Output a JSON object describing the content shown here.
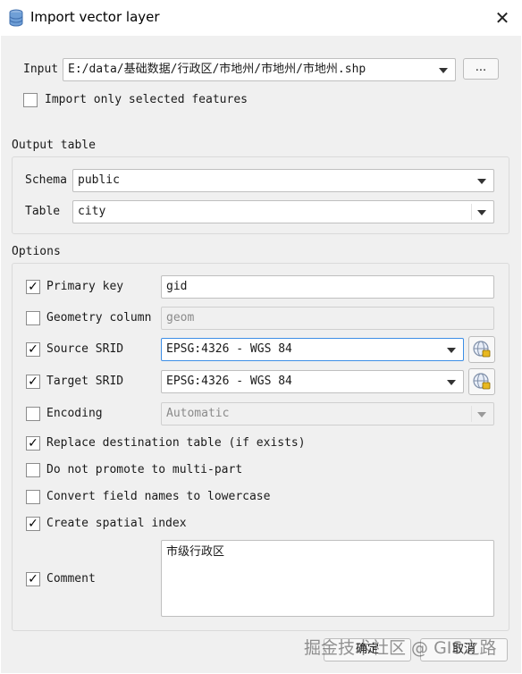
{
  "window": {
    "title": "Import vector layer",
    "icon": "database-icon",
    "close_glyph": "✕"
  },
  "input": {
    "label": "Input",
    "path": "E:/data/基础数据/行政区/市地州/市地州/市地州.shp",
    "browse_label": "...",
    "only_selected_label": "Import only selected features",
    "only_selected_checked": false
  },
  "output_table": {
    "group_label": "Output table",
    "schema_label": "Schema",
    "schema_value": "public",
    "table_label": "Table",
    "table_value": "city"
  },
  "options": {
    "group_label": "Options",
    "check_glyph": "✓",
    "primary_key": {
      "label": "Primary key",
      "checked": true,
      "value": "gid"
    },
    "geometry_column": {
      "label": "Geometry column",
      "checked": false,
      "value": "geom"
    },
    "source_srid": {
      "label": "Source SRID",
      "checked": true,
      "value": "EPSG:4326 - WGS 84"
    },
    "target_srid": {
      "label": "Target SRID",
      "checked": true,
      "value": "EPSG:4326 - WGS 84"
    },
    "encoding": {
      "label": "Encoding",
      "checked": false,
      "value": "Automatic"
    },
    "replace_table": {
      "label": "Replace destination table (if exists)",
      "checked": true
    },
    "no_multipart": {
      "label": "Do not promote to multi-part",
      "checked": false
    },
    "lowercase_fields": {
      "label": "Convert field names to lowercase",
      "checked": false
    },
    "spatial_index": {
      "label": "Create spatial index",
      "checked": true
    },
    "comment": {
      "label": "Comment",
      "checked": true,
      "value": "市级行政区"
    }
  },
  "buttons": {
    "ok": "确定",
    "cancel": "取消"
  },
  "watermark": "掘金技术社区 @ GIS之路",
  "colors": {
    "background": "#f0f0f0",
    "focus_border": "#3d8ee6",
    "title_bg": "#ffffff"
  }
}
